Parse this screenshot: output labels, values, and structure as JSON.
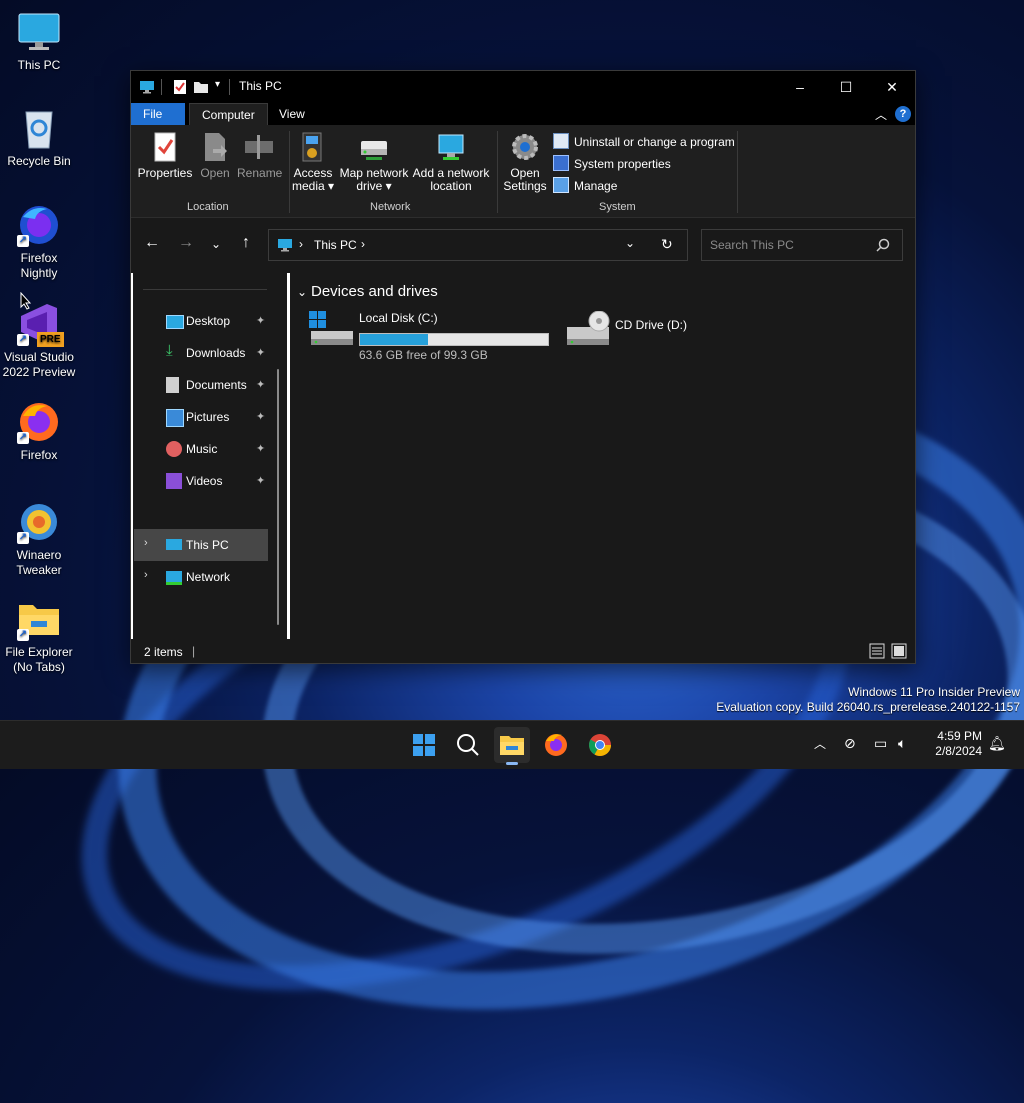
{
  "desktop": {
    "icons": [
      {
        "label": "This PC"
      },
      {
        "label": "Recycle Bin"
      },
      {
        "label": "Firefox Nightly"
      },
      {
        "label": "Visual Studio 2022 Preview",
        "badge": "PRE"
      },
      {
        "label": "Firefox"
      },
      {
        "label": "Winaero Tweaker"
      },
      {
        "label": "File Explorer (No Tabs)"
      }
    ]
  },
  "window": {
    "title": "This PC",
    "controls": {
      "minimize": "–",
      "maximize": "☐",
      "close": "✕"
    },
    "tabs": [
      "File",
      "Computer",
      "View"
    ],
    "help": "?",
    "ribbon": {
      "location": {
        "label": "Location",
        "buttons": [
          {
            "label": "Properties"
          },
          {
            "label": "Open"
          },
          {
            "label": "Rename"
          }
        ]
      },
      "network": {
        "label": "Network",
        "buttons": [
          {
            "line1": "Access",
            "line2": "media ▾"
          },
          {
            "line1": "Map network",
            "line2": "drive ▾"
          },
          {
            "line1": "Add a network",
            "line2": "location"
          }
        ]
      },
      "system": {
        "label": "System",
        "open_settings_1": "Open",
        "open_settings_2": "Settings",
        "items": [
          {
            "label": "Uninstall or change a program"
          },
          {
            "label": "System properties"
          },
          {
            "label": "Manage"
          }
        ]
      }
    },
    "address": {
      "path": "This PC"
    },
    "search": {
      "placeholder": "Search This PC"
    },
    "nav_pane": {
      "quick_access": [
        {
          "label": "Desktop",
          "icon": "desktop-icon"
        },
        {
          "label": "Downloads",
          "icon": "download-icon"
        },
        {
          "label": "Documents",
          "icon": "documents-icon"
        },
        {
          "label": "Pictures",
          "icon": "pictures-icon"
        },
        {
          "label": "Music",
          "icon": "music-icon"
        },
        {
          "label": "Videos",
          "icon": "videos-icon"
        }
      ],
      "this_pc": "This PC",
      "network": "Network"
    },
    "content": {
      "section_title": "Devices and drives",
      "drives": [
        {
          "name": "Local Disk (C:)",
          "free_text": "63.6 GB free of 99.3 GB",
          "used_fraction": 0.36
        },
        {
          "name": "CD Drive (D:)"
        }
      ]
    },
    "status": {
      "items": "2 items"
    }
  },
  "watermark": {
    "line1": "Windows 11 Pro Insider Preview",
    "line2": "Evaluation copy. Build 26040.rs_prerelease.240122-1157"
  },
  "taskbar": {
    "time": "4:59 PM",
    "date": "2/8/2024"
  },
  "colors": {
    "accent": "#1f6fd1",
    "progress": "#26a0da"
  }
}
